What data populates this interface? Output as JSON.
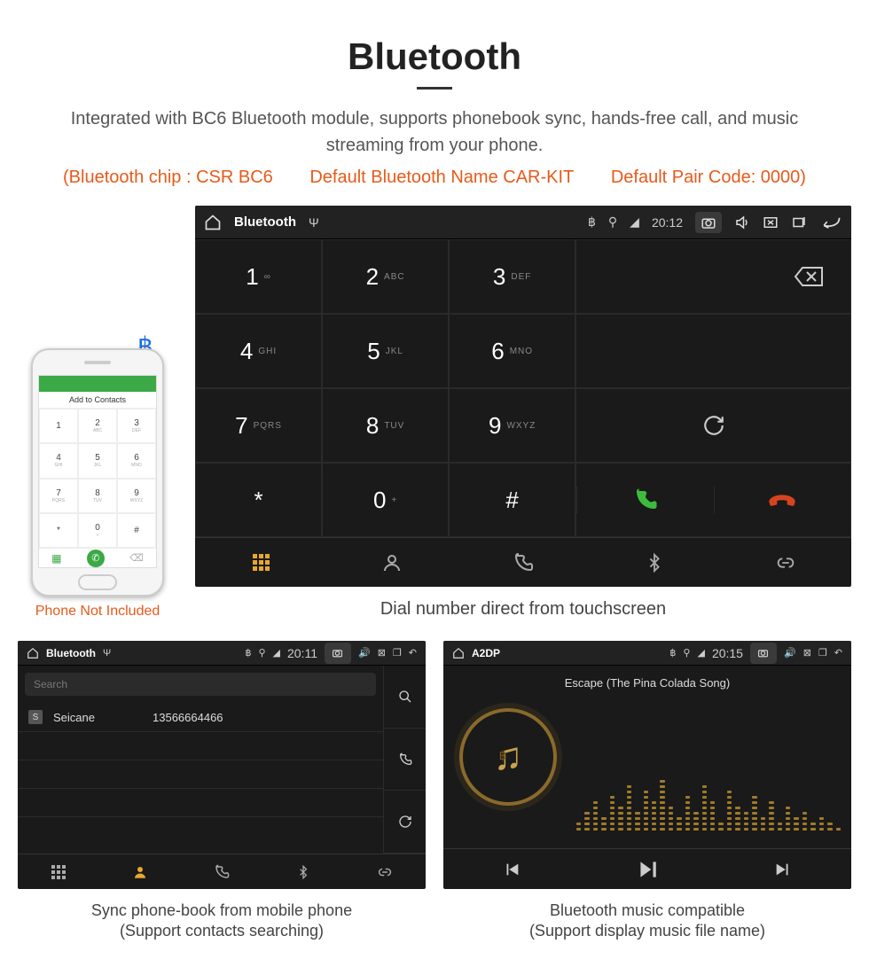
{
  "header": {
    "title": "Bluetooth",
    "description": "Integrated with BC6 Bluetooth module, supports phonebook sync, hands-free call, and music streaming from your phone.",
    "spec_chip": "(Bluetooth chip : CSR BC6",
    "spec_name": "Default Bluetooth Name CAR-KIT",
    "spec_code": "Default Pair Code: 0000)"
  },
  "phone_mock": {
    "add_contacts": "Add to Contacts",
    "note": "Phone Not Included",
    "keys": [
      {
        "n": "1",
        "s": ""
      },
      {
        "n": "2",
        "s": "ABC"
      },
      {
        "n": "3",
        "s": "DEF"
      },
      {
        "n": "4",
        "s": "GHI"
      },
      {
        "n": "5",
        "s": "JKL"
      },
      {
        "n": "6",
        "s": "MNO"
      },
      {
        "n": "7",
        "s": "PQRS"
      },
      {
        "n": "8",
        "s": "TUV"
      },
      {
        "n": "9",
        "s": "WXYZ"
      },
      {
        "n": "*",
        "s": ""
      },
      {
        "n": "0",
        "s": "+"
      },
      {
        "n": "#",
        "s": ""
      }
    ]
  },
  "dialer": {
    "status": {
      "title": "Bluetooth",
      "time": "20:12"
    },
    "keys": [
      {
        "n": "1",
        "s": "∞"
      },
      {
        "n": "2",
        "s": "ABC"
      },
      {
        "n": "3",
        "s": "DEF"
      },
      {
        "n": "4",
        "s": "GHI"
      },
      {
        "n": "5",
        "s": "JKL"
      },
      {
        "n": "6",
        "s": "MNO"
      },
      {
        "n": "7",
        "s": "PQRS"
      },
      {
        "n": "8",
        "s": "TUV"
      },
      {
        "n": "9",
        "s": "WXYZ"
      },
      {
        "n": "*",
        "s": ""
      },
      {
        "n": "0",
        "s": "+"
      },
      {
        "n": "#",
        "s": ""
      }
    ],
    "caption": "Dial number direct from touchscreen"
  },
  "phonebook": {
    "status": {
      "title": "Bluetooth",
      "time": "20:11"
    },
    "search_placeholder": "Search",
    "contact": {
      "badge": "S",
      "name": "Seicane",
      "number": "13566664466"
    },
    "caption_l1": "Sync phone-book from mobile phone",
    "caption_l2": "(Support contacts searching)"
  },
  "music": {
    "status": {
      "title": "A2DP",
      "time": "20:15"
    },
    "track": "Escape (The Pina Colada Song)",
    "eq_heights": [
      2,
      4,
      6,
      3,
      7,
      5,
      9,
      4,
      8,
      6,
      10,
      5,
      3,
      7,
      4,
      9,
      6,
      2,
      8,
      5,
      4,
      7,
      3,
      6,
      2,
      5,
      3,
      4,
      2,
      3,
      2,
      1
    ],
    "caption_l1": "Bluetooth music compatible",
    "caption_l2": "(Support display music file name)"
  }
}
